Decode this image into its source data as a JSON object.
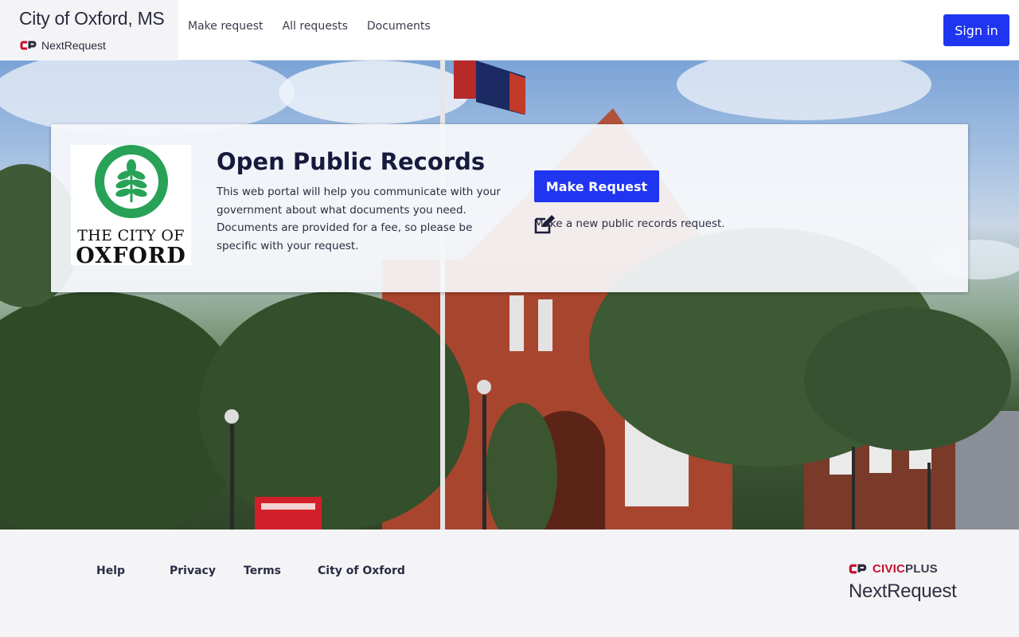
{
  "header": {
    "city_name": "City of Oxford, MS",
    "product_name": "NextRequest",
    "nav": [
      {
        "label": "Make request"
      },
      {
        "label": "All requests"
      },
      {
        "label": "Documents"
      }
    ],
    "sign_in_label": "Sign in"
  },
  "hero": {
    "logo": {
      "line1": "THE CITY OF",
      "line2": "OXFORD",
      "color": "#27a257"
    },
    "title": "Open Public Records",
    "description": "This web portal will help you communicate with your government about what documents you need. Documents are provided for a fee, so please be specific with your request.",
    "make_request_label": "Make Request",
    "new_request_text": "Make a new public records request.",
    "icons": {
      "edit": "edit-icon",
      "logo": "leaf-icon"
    }
  },
  "footer": {
    "links": [
      {
        "label": "Help"
      },
      {
        "label": "Privacy"
      },
      {
        "label": "Terms"
      },
      {
        "label": "City of Oxford"
      }
    ],
    "civicplus_prefix": "CIVIC",
    "civicplus_suffix": "PLUS",
    "nextrequest": "NextRequest"
  },
  "colors": {
    "accent": "#1f35f0",
    "brand_red": "#c8102e",
    "logo_green": "#27a257"
  }
}
